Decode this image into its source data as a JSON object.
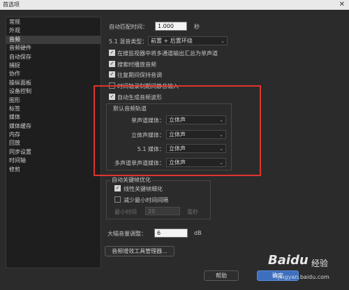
{
  "window": {
    "title": "首选项",
    "close_glyph": "✕"
  },
  "sidebar": {
    "items": [
      {
        "label": "常规"
      },
      {
        "label": "外观"
      },
      {
        "label": "音频",
        "active": true
      },
      {
        "label": "音频硬件"
      },
      {
        "label": "自动保存"
      },
      {
        "label": "捕捉"
      },
      {
        "label": "协作"
      },
      {
        "label": "操纵面板"
      },
      {
        "label": "设备控制"
      },
      {
        "label": "图形"
      },
      {
        "label": "标签"
      },
      {
        "label": "媒体"
      },
      {
        "label": "媒体缓存"
      },
      {
        "label": "内存"
      },
      {
        "label": "回放"
      },
      {
        "label": "同步设置"
      },
      {
        "label": "时间轴"
      },
      {
        "label": "修剪"
      }
    ]
  },
  "audio": {
    "auto_match_label": "自动匹配时间：",
    "auto_match_value": "1.000",
    "auto_match_unit": "秒",
    "mix_type_label": "5.1 混音类型：",
    "mix_type_value": "前置 + 后置环绕",
    "checks": [
      {
        "label": "在搜监视器中将多通道输出汇总为单声道",
        "checked": true
      },
      {
        "label": "搜索时播放音频",
        "checked": true
      },
      {
        "label": "往复期间保持音调",
        "checked": true
      },
      {
        "label": "时间轴录制期间静音输入",
        "checked": false
      },
      {
        "label": "自动生成音频波形",
        "checked": true
      }
    ],
    "default_tracks": {
      "title": "默认音频轨道",
      "rows": [
        {
          "label": "单声道媒体：",
          "value": "立体声"
        },
        {
          "label": "立体声媒体：",
          "value": "立体声"
        },
        {
          "label": "5.1 媒体：",
          "value": "立体声"
        },
        {
          "label": "多声道单声道媒体：",
          "value": "立体声"
        }
      ]
    },
    "keyframe": {
      "title": "自动关键帧优化",
      "linear_label": "线性关键帧细化",
      "linear_checked": true,
      "min_time_label": "减少最小时间间隔",
      "min_time_checked": false,
      "min_interval_label": "最小时间",
      "min_interval_value": "20",
      "min_interval_unit": "毫秒"
    },
    "max_gain_label": "大幅音量调整：",
    "max_gain_value": "6",
    "max_gain_unit": "dB",
    "plugin_manager_label": "音频增效工具管理器..."
  },
  "footer": {
    "help_label": "帮助",
    "ok_label": "确定"
  },
  "watermark": {
    "brand": "Baidu",
    "sub": "经验",
    "url": "jingyan.baidu.com"
  }
}
